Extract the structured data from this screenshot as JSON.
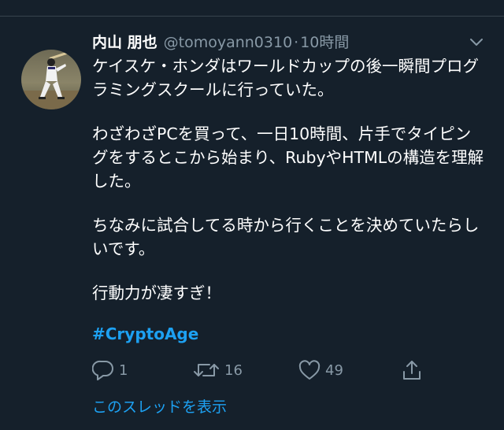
{
  "tweet": {
    "display_name": "内山 朋也",
    "handle": "@tomoyann0310",
    "separator": "·",
    "time": "10時間",
    "paragraphs": [
      "ケイスケ・ホンダはワールドカップの後一瞬間プログラミングスクールに行っていた。",
      "わざわざPCを買って、一日10時間、片手でタイピングをするとこから始まり、RubyやHTMLの構造を理解した。",
      "ちなみに試合してる時から行くことを決めていたらしいです。",
      "行動力が凄すぎ！"
    ],
    "hashtag": "#CryptoAge",
    "actions": {
      "reply_count": "1",
      "retweet_count": "16",
      "like_count": "49"
    },
    "thread_link": "このスレッドを表示"
  },
  "colors": {
    "background": "#15202b",
    "text": "#ffffff",
    "secondary": "#8899a6",
    "accent": "#1da1f2",
    "divider": "#38444d"
  },
  "icons": [
    "avatar-photo",
    "chevron-down-icon",
    "reply-icon",
    "retweet-icon",
    "like-icon",
    "share-icon"
  ]
}
